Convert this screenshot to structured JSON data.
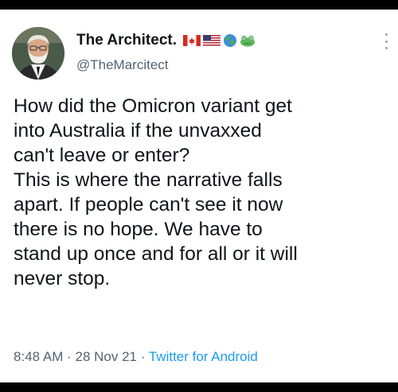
{
  "tweet": {
    "display_name": "The Architect.",
    "handle": "@TheMarcitect",
    "text": "How did the Omicron variant get\ninto Australia if the unvaxxed\ncan't leave or enter?\nThis is where the narrative falls\napart. If people can't see it now\nthere is no hope. We have to\nstand up once and for all or it will\nnever stop.",
    "time": "8:48 AM",
    "separator": "·",
    "date": "28 Nov 21",
    "source": "Twitter for Android"
  },
  "emoji": [
    "canada-flag-icon",
    "usa-flag-icon",
    "earth-globe-icon",
    "frog-icon"
  ],
  "colors": {
    "text": "#0f1419",
    "secondary": "#536471",
    "link": "#1d9bf0",
    "background": "#ffffff"
  }
}
